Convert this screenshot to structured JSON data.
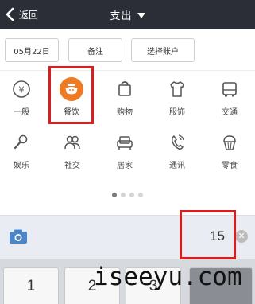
{
  "header": {
    "back_label": "返回",
    "title": "支出"
  },
  "buttons": {
    "date": "05月22日",
    "note": "备注",
    "account": "选择账户"
  },
  "categories": [
    {
      "label": "一般",
      "icon": "yen-circle-icon"
    },
    {
      "label": "餐饮",
      "icon": "rice-bowl-icon",
      "selected": true,
      "accent": "#f07a22"
    },
    {
      "label": "购物",
      "icon": "shopping-bag-icon"
    },
    {
      "label": "服饰",
      "icon": "shirt-icon"
    },
    {
      "label": "交通",
      "icon": "bus-icon"
    },
    {
      "label": "娱乐",
      "icon": "microphone-icon"
    },
    {
      "label": "社交",
      "icon": "people-icon"
    },
    {
      "label": "居家",
      "icon": "sofa-icon"
    },
    {
      "label": "通讯",
      "icon": "phone-icon"
    },
    {
      "label": "零食",
      "icon": "cupcake-icon"
    }
  ],
  "pager": {
    "total": 4,
    "active": 1
  },
  "amount": {
    "value": "15"
  },
  "keypad": {
    "keys": [
      "1",
      "2",
      "3"
    ]
  },
  "watermark": "iseeyu.com"
}
